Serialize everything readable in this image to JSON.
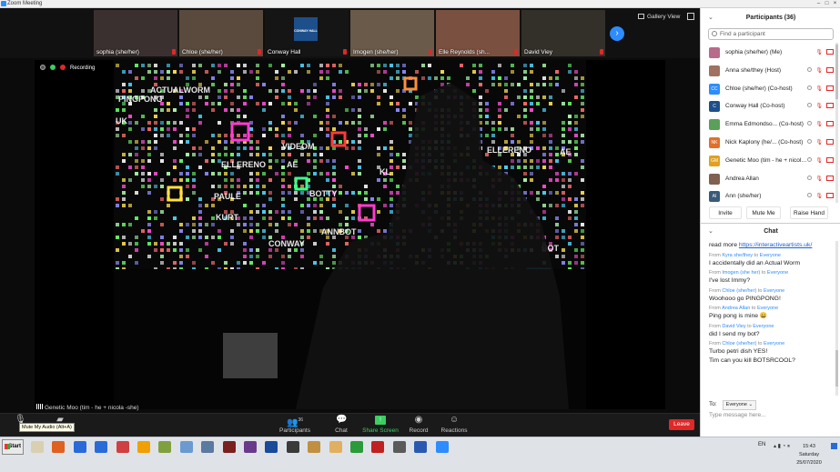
{
  "window": {
    "title": "Zoom Meeting"
  },
  "thumbnails": [
    {
      "name": "sophia (she/her)",
      "bg": "#3b3030"
    },
    {
      "name": "Chloe (she/her)",
      "bg": "#5a4a3e"
    },
    {
      "name": "Conway Hall",
      "bg": "#151515",
      "logo_text": "CONWAY HALL"
    },
    {
      "name": "Imogen (she/her)",
      "bg": "#6a5a4a"
    },
    {
      "name": "Elle Reynolds (sh...",
      "bg": "#7a5040"
    },
    {
      "name": "David Viey",
      "bg": "#33302a"
    }
  ],
  "view": {
    "gallery_label": "Gallery View"
  },
  "status": {
    "recording_label": "Recording"
  },
  "speaker": {
    "name": "Genetic Moo (tim - he + nicola -she)"
  },
  "scene_words": [
    "ACTUALWORM",
    "PINGPONG",
    "UK",
    "VIDEOM",
    "ELLERENO",
    "AE",
    "KL",
    "BOTTY",
    "PAULE",
    "KURT",
    "ANNBOT",
    "CONWAY",
    "ELLERENO",
    "AE",
    "BOT"
  ],
  "toolbar": {
    "mic_tooltip": "Mute My Audio (Alt+A)",
    "participants_label": "Participants",
    "participants_count": "36",
    "chat_label": "Chat",
    "share_label": "Share Screen",
    "record_label": "Record",
    "reactions_label": "Reactions",
    "leave_label": "Leave"
  },
  "participants_panel": {
    "title": "Participants (36)",
    "search_placeholder": "Find a participant",
    "participants": [
      {
        "name": "sophia (she/her) (Me)",
        "initials": "",
        "color": "#b86a8a"
      },
      {
        "name": "Anna she/they (Host)",
        "initials": "",
        "color": "#a07060"
      },
      {
        "name": "Chloe (she/her) (Co-host)",
        "initials": "CC",
        "color": "#2d8cff"
      },
      {
        "name": "Conway Hall (Co-host)",
        "initials": "C",
        "color": "#1d4f8a"
      },
      {
        "name": "Emma Edmondso... (Co-host)",
        "initials": "",
        "color": "#5aa05a"
      },
      {
        "name": "Nick Kaplony (he/... (Co-host)",
        "initials": "NK",
        "color": "#e0702a"
      },
      {
        "name": "Genetic Moo (tim - he + nicola ...",
        "initials": "GM",
        "color": "#e0a020"
      },
      {
        "name": "Andrea Allan",
        "initials": "",
        "color": "#806050"
      },
      {
        "name": "Ann (she/her)",
        "initials": "AI",
        "color": "#3a5a7a"
      }
    ],
    "buttons": [
      "Invite",
      "Mute Me",
      "Raise Hand"
    ]
  },
  "chat_panel": {
    "title": "Chat",
    "messages": [
      {
        "from": "",
        "to": "",
        "lines": [
          "read more "
        ],
        "link": "https://interactiveartists.uk/"
      },
      {
        "from": "Kyra she/they",
        "to": "Everyone",
        "lines": [
          "I accidentally did an Actual Worm"
        ]
      },
      {
        "from": "Imogen (she her)",
        "to": "Everyone",
        "lines": [
          "I've lost Immy?"
        ]
      },
      {
        "from": "Chloe (she/her)",
        "to": "Everyone",
        "lines": [
          "Woohooo go PINGPONG!"
        ]
      },
      {
        "from": "Andrea Allan",
        "to": "Everyone",
        "lines": [
          "Ping pong is mine 😀"
        ]
      },
      {
        "from": "David Viey",
        "to": "Everyone",
        "lines": [
          "did I send my bot?"
        ]
      },
      {
        "from": "Chloe (she/her)",
        "to": "Everyone",
        "lines": [
          "Turbo petri dish YES!",
          "Tim can you kill BOTSRCOOL?"
        ]
      }
    ],
    "from_prefix": "From",
    "to_word": "to",
    "to_label": "To:",
    "to_value": "Everyone",
    "input_placeholder": "Type message here..."
  },
  "taskbar": {
    "start_label": "Start",
    "lang": "EN",
    "time": "15:43",
    "day": "Saturday",
    "date": "25/07/2020",
    "apps": [
      "#d8d0b0",
      "#e06020",
      "#2a6ad8",
      "#2a6ad8",
      "#d04040",
      "#f0a000",
      "#80a040",
      "#6a9ad0",
      "#5a7aa0",
      "#7a2020",
      "#6a3a8a",
      "#1a4a9a",
      "#3a3a3a",
      "#c09040",
      "#e0b060",
      "#2a9a3a",
      "#c02020",
      "#5a5a5a",
      "#2a5ab0",
      "#2d8cff"
    ]
  }
}
